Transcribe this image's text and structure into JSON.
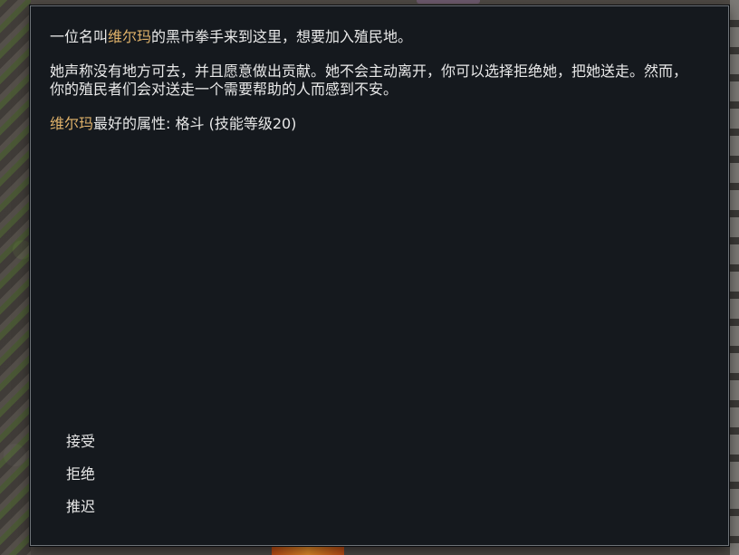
{
  "dialog": {
    "line1": {
      "before": "一位名叫",
      "name": "维尔玛",
      "after": "的黑市拳手来到这里，想要加入殖民地。"
    },
    "paragraph2": "她声称没有地方可去，并且愿意做出贡献。她不会主动离开，你可以选择拒绝她，把她送走。然而，你的殖民者们会对送走一个需要帮助的人而感到不安。",
    "line3": {
      "name": "维尔玛",
      "after": "最好的属性: 格斗 (技能等级20)"
    },
    "options": [
      {
        "label": "接受"
      },
      {
        "label": "拒绝"
      },
      {
        "label": "推迟"
      }
    ]
  },
  "colors": {
    "dialog_bg": "#15191e",
    "text": "#e9e9e9",
    "name_highlight": "#e0b26a",
    "border": "#6e7378"
  }
}
